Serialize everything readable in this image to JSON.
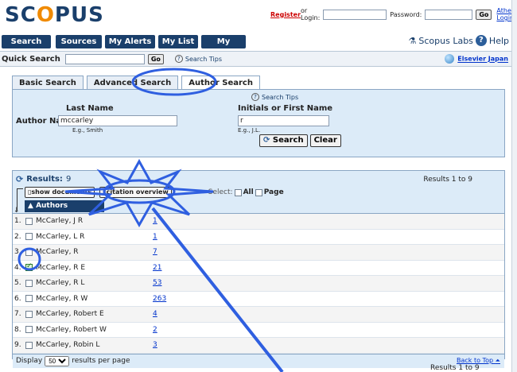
{
  "header": {
    "logo": "SCOPUS",
    "register_link": "Register",
    "or_login": " or Login:",
    "password_label": "Password:",
    "go_label": "Go",
    "athens_link": "Athens Login"
  },
  "nav": {
    "items": [
      "Search",
      "Sources",
      "My Alerts",
      "My List",
      "My Profile"
    ],
    "labs": "Scopus Labs",
    "help": "Help"
  },
  "quick_search": {
    "label": "Quick Search",
    "value": "",
    "go_label": "Go",
    "tips": "Search Tips",
    "elsevier": "Elsevier Japan"
  },
  "search_tabs": [
    "Basic Search",
    "Advanced Search",
    "Author Search"
  ],
  "author_search": {
    "tips": "Search Tips",
    "last_name_label": "Last Name",
    "initials_label": "Initials or First Name",
    "author_name_label": "Author Name:",
    "last_name_value": "mccarley",
    "initials_value": "r",
    "last_name_example": "E.g., Smith",
    "initials_example": "E.g., J.L.",
    "search_button": "Search",
    "clear_button": "Clear"
  },
  "results": {
    "label": "Results:",
    "count": "9",
    "range_top": "Results 1 to 9",
    "show_documents": "show documents",
    "citation_overview": "citation overview",
    "select_label": "Select:",
    "all_label": "All",
    "page_label": "Page",
    "column_header": "Authors",
    "rows": [
      {
        "num": "1.",
        "name": "McCarley, J R",
        "docs": "1",
        "checked": false
      },
      {
        "num": "2.",
        "name": "McCarley, L R",
        "docs": "1",
        "checked": false
      },
      {
        "num": "3.",
        "name": "McCarley, R",
        "docs": "7",
        "checked": false
      },
      {
        "num": "4.",
        "name": "McCarley, R E",
        "docs": "21",
        "checked": true
      },
      {
        "num": "5.",
        "name": "McCarley, R L",
        "docs": "53",
        "checked": false
      },
      {
        "num": "6.",
        "name": "McCarley, R W",
        "docs": "263",
        "checked": false
      },
      {
        "num": "7.",
        "name": "McCarley, Robert E",
        "docs": "4",
        "checked": false
      },
      {
        "num": "8.",
        "name": "McCarley, Robert W",
        "docs": "2",
        "checked": false
      },
      {
        "num": "9.",
        "name": "McCarley, Robin L",
        "docs": "3",
        "checked": false
      }
    ],
    "display_label": "Display",
    "per_page_value": "50",
    "per_page_suffix": "results per page",
    "back_to_top": "Back to Top",
    "range_bottom": "Results 1 to 9"
  },
  "colors": {
    "brand_navy": "#1a3f6b",
    "panel_blue": "#dcebf8",
    "annotation_blue": "#2f5fe0"
  }
}
